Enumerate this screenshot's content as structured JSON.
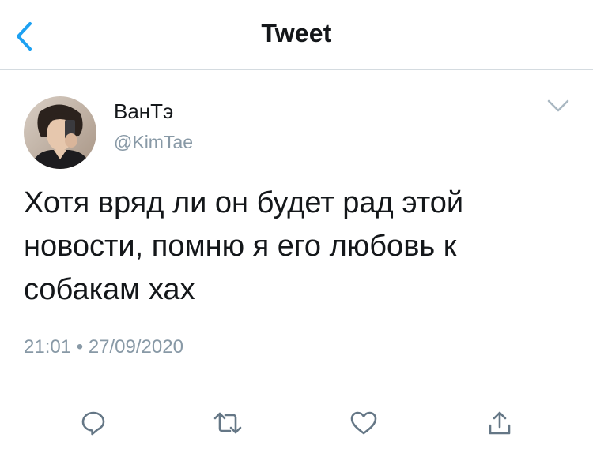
{
  "header": {
    "title": "Tweet",
    "back_icon": "chevron-left-icon"
  },
  "author": {
    "display_name": "ВанТэ",
    "handle": "@KimTae"
  },
  "tweet": {
    "text": "Хотя вряд ли он будет рад этой новости, помню я его любовь к собакам хах",
    "time": "21:01",
    "separator": "•",
    "date": "27/09/2020"
  },
  "actions": {
    "reply_icon": "reply-icon",
    "retweet_icon": "retweet-icon",
    "like_icon": "heart-icon",
    "share_icon": "share-icon"
  },
  "colors": {
    "accent": "#1da1f2",
    "icon_gray": "#657786",
    "secondary_text": "#8899a6",
    "divider": "#d4dbe0"
  }
}
